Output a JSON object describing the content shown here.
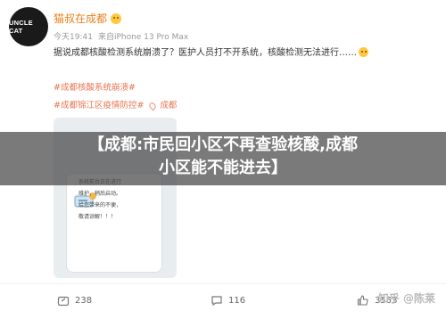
{
  "author": {
    "avatar_text": "UNCLE CAT",
    "name": "猫叔在成都"
  },
  "meta": {
    "time": "今天19:41",
    "device": "来自iPhone 13 Pro Max"
  },
  "post": {
    "text": "据说成都核酸检测系统崩溃了？医护人员打不开系统，核酸检测无法进行……"
  },
  "hashtags": {
    "tag1": "#成都核酸系统崩溃#",
    "tag2": "#成都锦江区疫情防控#",
    "location": "成都"
  },
  "image": {
    "notice_lines": [
      "系统前台正在进行",
      "维护，稍后启动。",
      "给您带来的不便，",
      "敬请谅解！！！"
    ]
  },
  "banner": {
    "line1": "【成都:市民回小区不再查验核酸,成都",
    "line2": "小区能不能进去】"
  },
  "footer": {
    "shares": "238",
    "comments": "116",
    "likes": "3553",
    "watermark": "知乎 @陈莱"
  },
  "colors": {
    "accent": "#eb7350",
    "author": "#e8811a"
  }
}
